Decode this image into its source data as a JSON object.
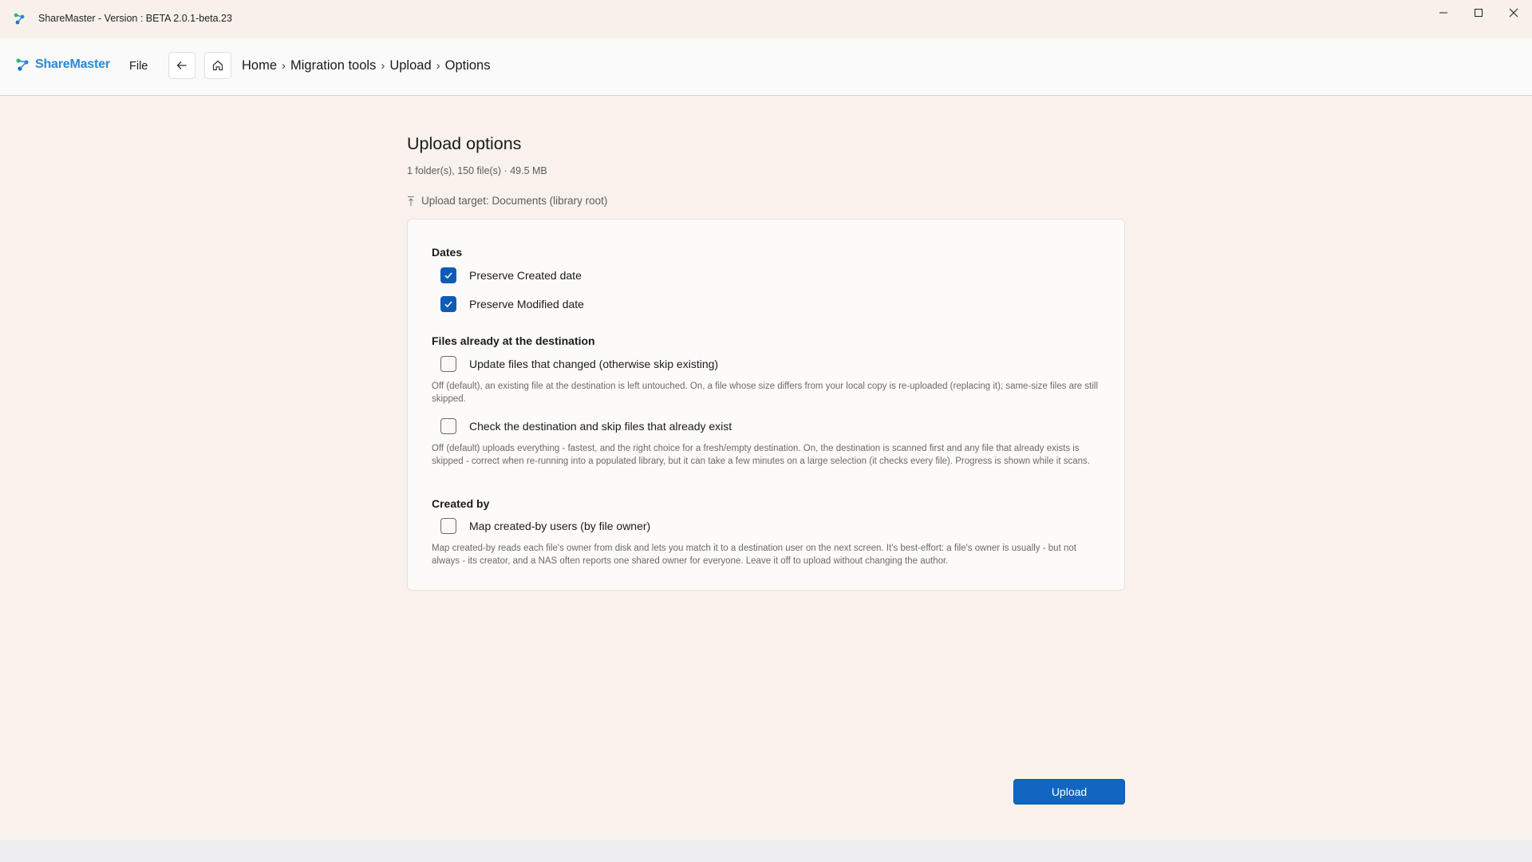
{
  "window": {
    "title": "ShareMaster - Version : BETA 2.0.1-beta.23"
  },
  "navbar": {
    "brand": "ShareMaster",
    "file_menu": "File",
    "breadcrumb": [
      "Home",
      "Migration tools",
      "Upload",
      "Options"
    ]
  },
  "page": {
    "title": "Upload options",
    "summary": "1 folder(s), 150 file(s) · 49.5 MB",
    "target": "Upload target: Documents (library root)"
  },
  "sections": {
    "dates": {
      "title": "Dates",
      "preserve_created": {
        "label": "Preserve Created date",
        "checked": true
      },
      "preserve_modified": {
        "label": "Preserve Modified date",
        "checked": true
      }
    },
    "existing": {
      "title": "Files already at the destination",
      "update_changed": {
        "label": "Update files that changed (otherwise skip existing)",
        "checked": false,
        "description": "Off (default), an existing file at the destination is left untouched. On, a file whose size differs from your local copy is re-uploaded (replacing it); same-size files are still skipped."
      },
      "check_destination": {
        "label": "Check the destination and skip files that already exist",
        "checked": false,
        "description": "Off (default) uploads everything - fastest, and the right choice for a fresh/empty destination. On, the destination is scanned first and any file that already exists is skipped - correct when re-running into a populated library, but it can take a few minutes on a large selection (it checks every file). Progress is shown while it scans."
      }
    },
    "created_by": {
      "title": "Created by",
      "map_users": {
        "label": "Map created-by users (by file owner)",
        "checked": false,
        "description": "Map created-by reads each file's owner from disk and lets you match it to a destination user on the next screen. It's best-effort: a file's owner is usually - but not always - its creator, and a NAS often reports one shared owner for everyone. Leave it off to upload without changing the author."
      }
    }
  },
  "actions": {
    "upload_label": "Upload"
  },
  "colors": {
    "accent": "#1066c0",
    "brand": "#2b88d8",
    "background": "#f9f2ec"
  }
}
